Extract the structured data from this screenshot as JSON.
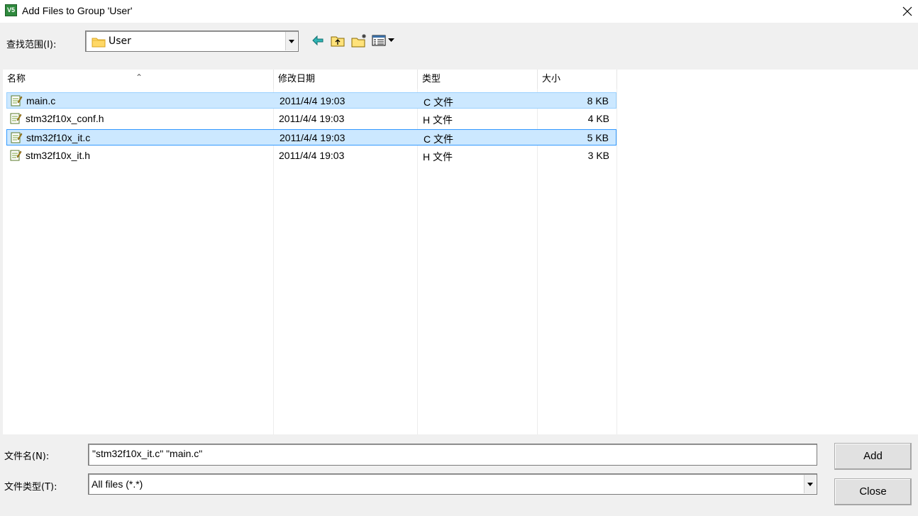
{
  "window": {
    "title": "Add Files to Group 'User'",
    "app_icon_text": "V5"
  },
  "lookin": {
    "label": "查找范围(I):",
    "value": "User",
    "icons": [
      "back-icon",
      "up-folder-icon",
      "new-folder-icon",
      "view-menu-icon"
    ]
  },
  "list": {
    "columns": [
      "名称",
      "修改日期",
      "类型",
      "大小"
    ],
    "rows": [
      {
        "name": "main.c",
        "date": "2011/4/4 19:03",
        "type": "C 文件",
        "size": "8 KB",
        "selected": true
      },
      {
        "name": "stm32f10x_conf.h",
        "date": "2011/4/4 19:03",
        "type": "H 文件",
        "size": "4 KB",
        "selected": false
      },
      {
        "name": "stm32f10x_it.c",
        "date": "2011/4/4 19:03",
        "type": "C 文件",
        "size": "5 KB",
        "selected": true
      },
      {
        "name": "stm32f10x_it.h",
        "date": "2011/4/4 19:03",
        "type": "H 文件",
        "size": "3 KB",
        "selected": false
      }
    ]
  },
  "footer": {
    "filename_label": "文件名(N):",
    "filename_value": "\"stm32f10x_it.c\" \"main.c\"",
    "filetype_label": "文件类型(T):",
    "filetype_value": "All files (*.*)",
    "add_label": "Add",
    "close_label": "Close"
  },
  "colors": {
    "selection_bg": "#cce8ff",
    "selection_border": "#99d1ff",
    "focus_border": "#3399ff",
    "dialog_bg": "#f0f0f0"
  }
}
